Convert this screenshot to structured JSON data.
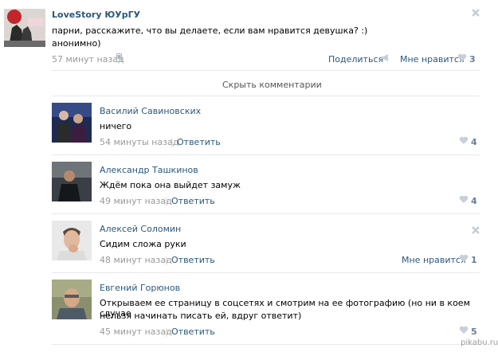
{
  "post": {
    "author": "LoveStory ЮУрГУ",
    "text_line1": "парни, расскажите, что вы делаете, если вам нравится девушка? :)",
    "text_line2": "анонимно)",
    "time": "57 минут назад",
    "share_label": "Поделиться",
    "like_label": "Мне нравится",
    "like_count": "3"
  },
  "hide_comments_label": "Скрыть комментарии",
  "comments": [
    {
      "name": "Василий Савиновских",
      "text": "ничего",
      "time": "54 минуты назад",
      "reply": "Ответить",
      "likes": "4"
    },
    {
      "name": "Александр Ташкинов",
      "text": "Ждём пока она выйдет замуж",
      "time": "49 минут назад",
      "reply": "Ответить",
      "likes": "4"
    },
    {
      "name": "Алексей Соломин",
      "text": "Сидим сложа руки",
      "time": "48 минут назад",
      "reply": "Ответить",
      "like_label": "Мне нравится",
      "likes": "1"
    },
    {
      "name": "Евгений Горюнов",
      "text_line1": "Открываем ее страницу в соцсетях и смотрим на ее фотографию (но ни в коем случае",
      "text_line2": "нельзя начинать писать ей, вдруг ответит)",
      "time": "45 минут назад",
      "reply": "Ответить",
      "likes": "5"
    }
  ],
  "watermark": "pikabu.ru",
  "icons": {
    "like": "heart-icon",
    "share": "megaphone-icon",
    "phone": "phone-icon",
    "close": "close-icon"
  }
}
